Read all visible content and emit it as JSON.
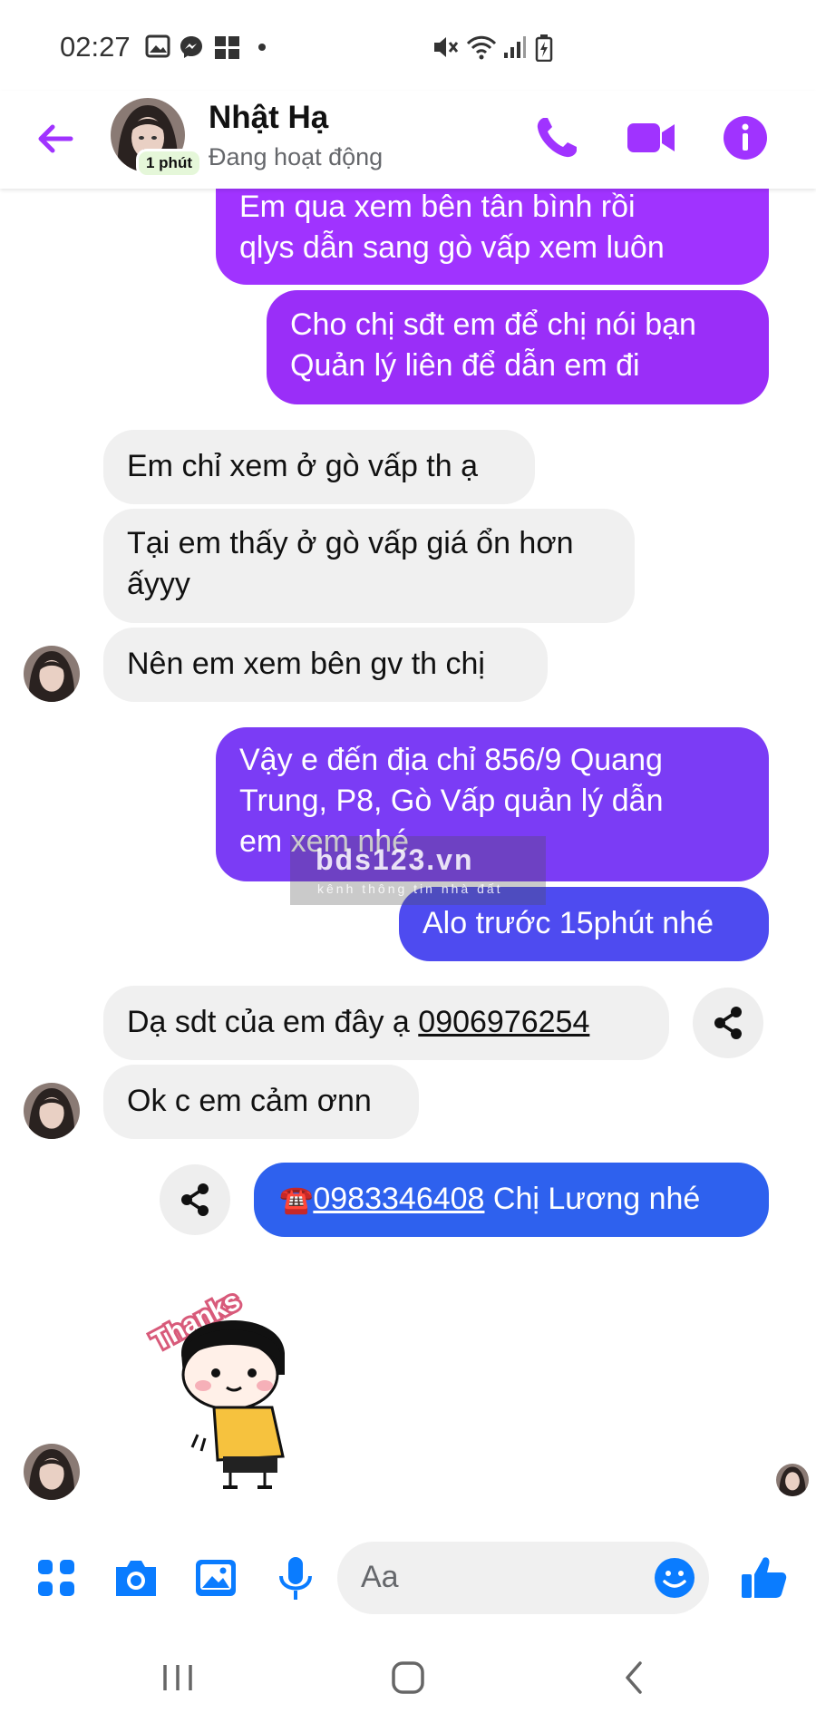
{
  "status_bar": {
    "time": "02:27",
    "icons": [
      "image-icon",
      "messenger-icon",
      "mb-icon",
      "dot-icon",
      "mute-icon",
      "wifi-icon",
      "signal-icon",
      "battery-icon"
    ]
  },
  "header": {
    "contact_name": "Nhật Hạ",
    "active_badge": "1 phút",
    "status": "Đang hoạt động",
    "accent_color": "#a033ff"
  },
  "messages": [
    {
      "from": "me",
      "text_line1": "Em qua xem bên tân bình rồi",
      "text_line2": "qlys dẫn sang gò vấp xem luôn"
    },
    {
      "from": "me",
      "text_line1": "Cho chị sđt em để chị nói bạn",
      "text_line2": "Quản lý liên để dẫn em đi"
    },
    {
      "from": "them",
      "text": "Em chỉ xem ở gò vấp th ạ"
    },
    {
      "from": "them",
      "text_line1": "Tại em thấy ở gò vấp giá ổn hơn",
      "text_line2": "ấyyy"
    },
    {
      "from": "them",
      "text": "Nên em xem bên gv th chị"
    },
    {
      "from": "me",
      "text_line1": "Vậy e đến địa chỉ 856/9 Quang",
      "text_line2": "Trung, P8, Gò Vấp quản lý dẫn",
      "text_line3": "em xem nhé"
    },
    {
      "from": "me",
      "text": "Alo trước 15phút nhé"
    },
    {
      "from": "them",
      "text_prefix": "Dạ sdt của em đây ạ ",
      "phone": "0906976254"
    },
    {
      "from": "them",
      "text": "Ok c em cảm ơnn"
    },
    {
      "from": "me",
      "emoji": "☎️",
      "phone": "0983346408",
      "text_suffix": " Chị Lương nhé"
    }
  ],
  "sticker": {
    "text": "Thanks"
  },
  "watermark": {
    "main": "bds123.vn",
    "sub": "kênh thông tin nhà đất"
  },
  "composer": {
    "placeholder": "Aa"
  },
  "colors": {
    "purple": "#a033ff",
    "violet": "#7b3cf5",
    "indigo": "#4e4bf0",
    "blue": "#2e61ee",
    "icon_blue": "#0a7cff"
  }
}
